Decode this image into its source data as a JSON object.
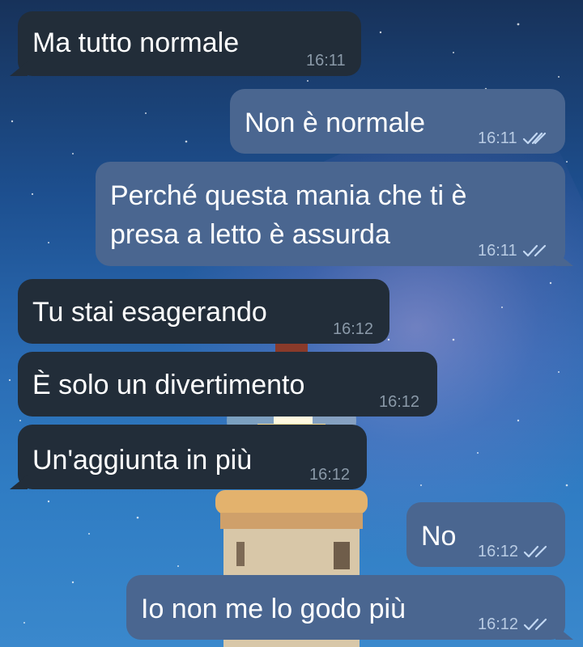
{
  "chat": {
    "accent_incoming_bubble": "#222d39",
    "accent_outgoing_bubble": "#4a6690",
    "read_tick_color": "#c3d8f3",
    "messages": [
      {
        "direction": "in",
        "text": "Ma tutto normale",
        "time": "16:11"
      },
      {
        "direction": "out",
        "text": "Non è normale",
        "time": "16:11",
        "status_icon": "double-check-icon"
      },
      {
        "direction": "out",
        "text": "Perché questa mania che ti è\npresa a letto è assurda",
        "time": "16:11",
        "status_icon": "double-check-icon"
      },
      {
        "direction": "in",
        "text": "Tu stai esagerando",
        "time": "16:12"
      },
      {
        "direction": "in",
        "text": "È solo un divertimento",
        "time": "16:12"
      },
      {
        "direction": "in",
        "text": "Un'aggiunta in più",
        "time": "16:12"
      },
      {
        "direction": "out",
        "text": "No",
        "time": "16:12",
        "status_icon": "double-check-icon"
      },
      {
        "direction": "out",
        "text": "Io non me lo godo più",
        "time": "16:12",
        "status_icon": "double-check-icon"
      }
    ]
  }
}
